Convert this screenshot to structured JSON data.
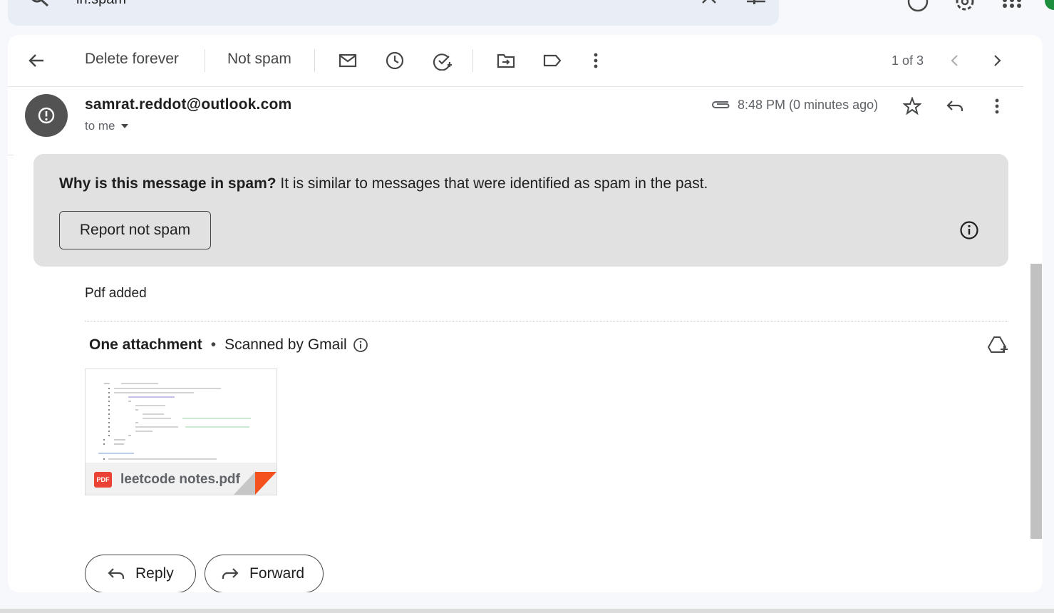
{
  "search": {
    "query": "in:spam"
  },
  "toolbar": {
    "delete_forever": "Delete forever",
    "not_spam": "Not spam",
    "pager": "1 of 3"
  },
  "message": {
    "sender": "samrat.reddot@outlook.com",
    "recipient": "to me",
    "time": "8:48 PM (0 minutes ago)",
    "body": "Pdf added"
  },
  "spam_banner": {
    "question": "Why is this message in spam?",
    "reason": " It is similar to messages that were identified as spam in the past.",
    "report_label": "Report not spam"
  },
  "attachments": {
    "count_label": "One attachment",
    "separator": "•",
    "scanned_label": "Scanned by Gmail",
    "file": {
      "name": "leetcode notes.pdf",
      "badge": "PDF"
    }
  },
  "actions": {
    "reply": "Reply",
    "forward": "Forward"
  },
  "colors": {
    "avatar": "#535353",
    "banner": "#e1e1e1",
    "pdf": "#ea4335"
  }
}
